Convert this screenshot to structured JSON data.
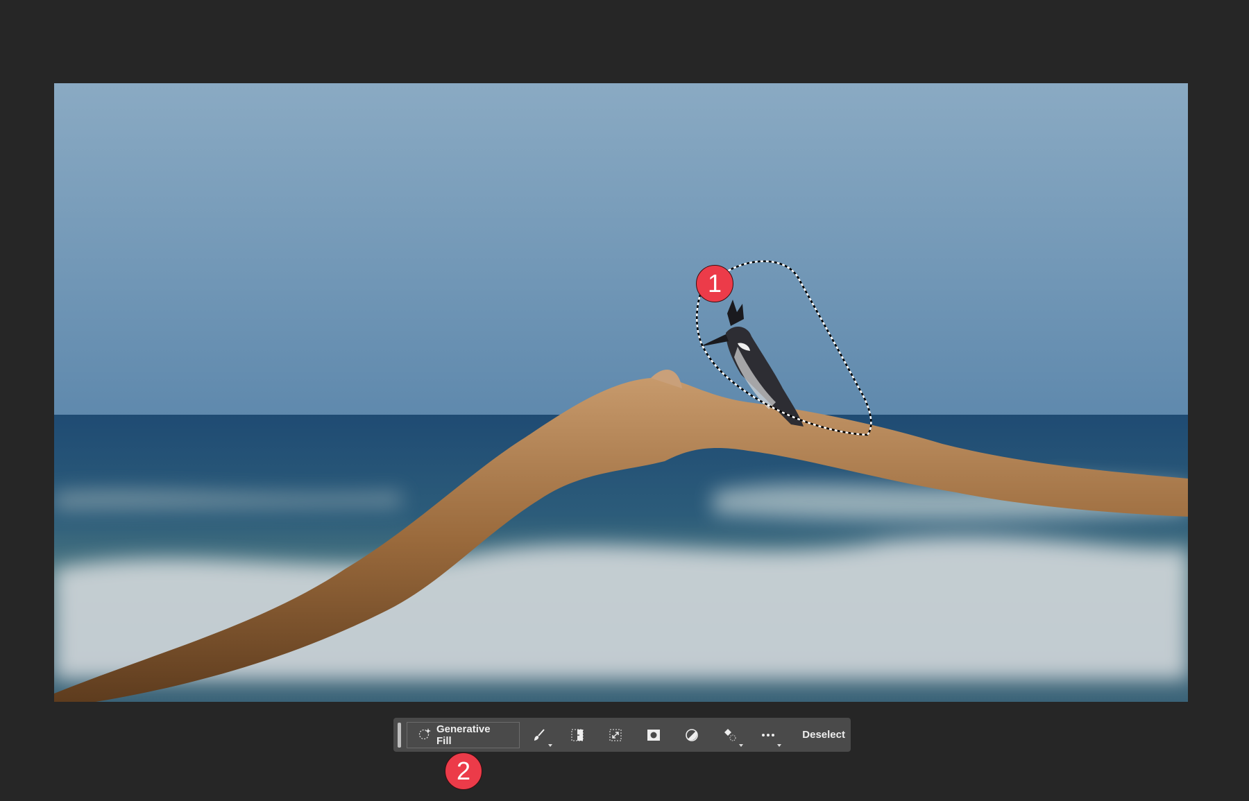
{
  "canvas": {
    "description_label": "photo-canvas"
  },
  "toolbar": {
    "generative_fill_label": "Generative Fill",
    "tools": [
      {
        "icon": "brush-icon",
        "has_menu": true
      },
      {
        "icon": "select-subject-icon",
        "has_menu": false
      },
      {
        "icon": "transform-selection-icon",
        "has_menu": false
      },
      {
        "icon": "mask-icon",
        "has_menu": false
      },
      {
        "icon": "adjustment-icon",
        "has_menu": false
      },
      {
        "icon": "fill-bucket-icon",
        "has_menu": true
      },
      {
        "icon": "more-icon",
        "has_menu": true
      }
    ],
    "deselect_label": "Deselect"
  },
  "callouts": {
    "one": "1",
    "two": "2"
  },
  "colors": {
    "badge": "#ec3b49",
    "toolbar": "#4a4a4a",
    "background": "#262626"
  }
}
